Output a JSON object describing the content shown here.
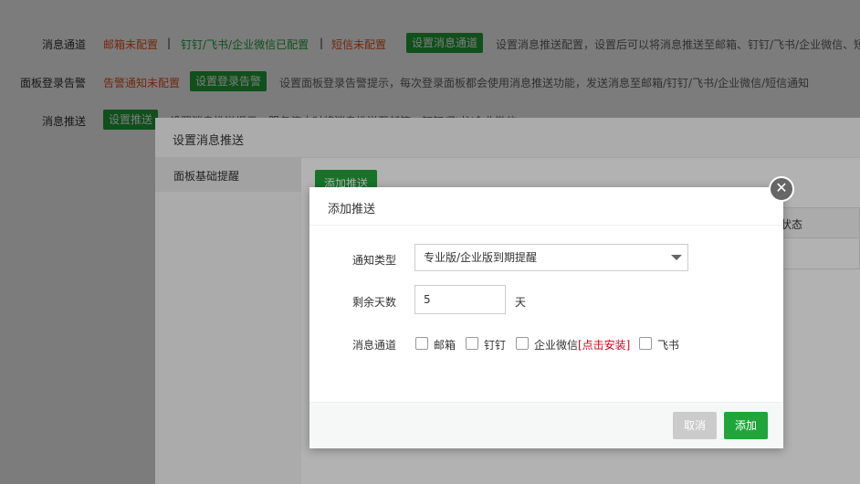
{
  "settings": {
    "row1": {
      "label": "消息通道",
      "email_status": "邮箱未配置",
      "sep1": "|",
      "im_status": "钉钉/飞书/企业微信已配置",
      "sep2": "|",
      "sms_status": "短信未配置",
      "button": "设置消息通道",
      "desc": "设置消息推送配置，设置后可以将消息推送至邮箱、钉钉/飞书/企业微信、短"
    },
    "row2": {
      "label": "面板登录告警",
      "status": "告警通知未配置",
      "button": "设置登录告警",
      "desc": "设置面板登录告警提示，每次登录面板都会使用消息推送功能，发送消息至邮箱/钉钉/飞书/企业微信/短信通知"
    },
    "row3": {
      "label": "消息推送",
      "button": "设置推送",
      "desc": "设置消息推送提示，服务停止时将消息推送至邮箱、钉钉/飞书/企业微信"
    }
  },
  "push_layer": {
    "title": "设置消息推送",
    "sidebar_item": "面板基础提醒",
    "add_button": "添加推送",
    "table_col_status": "状态"
  },
  "dialog": {
    "title": "添加推送",
    "close_glyph": "✕",
    "notify_type_label": "通知类型",
    "notify_type_value": "专业版/企业版到期提醒",
    "days_label": "剩余天数",
    "days_value": "5",
    "days_unit": "天",
    "channel_label": "消息通道",
    "channels": [
      {
        "label": "邮箱"
      },
      {
        "label": "钉钉"
      },
      {
        "label": "企业微信",
        "extra": "[点击安装]"
      },
      {
        "label": "飞书"
      }
    ],
    "cancel_label": "取消",
    "add_label": "添加"
  },
  "colors": {
    "accent": "#20a53a",
    "warning": "#e8541f",
    "link_red": "#d9001b"
  }
}
